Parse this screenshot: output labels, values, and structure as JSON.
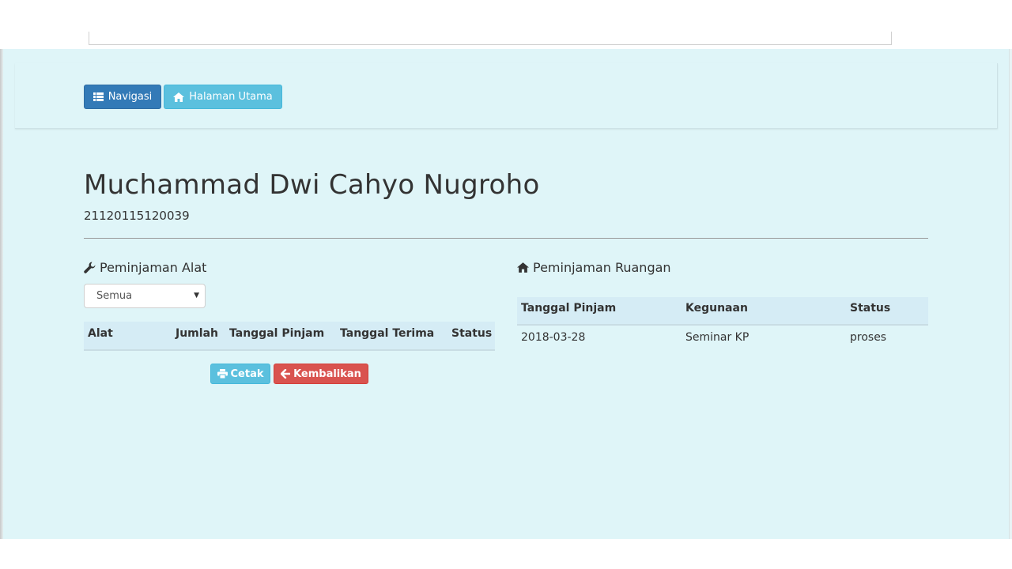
{
  "navbar": {
    "nav_label": "Navigasi",
    "home_label": "Halaman Utama"
  },
  "profile": {
    "name": "Muchammad Dwi Cahyo Nugroho",
    "nim": "21120115120039"
  },
  "alat": {
    "title": "Peminjaman Alat",
    "filter_value": "Semua",
    "columns": [
      "Alat",
      "Jumlah",
      "Tanggal Pinjam",
      "Tanggal Terima",
      "Status"
    ],
    "rows": [],
    "print_label": "Cetak",
    "return_label": "Kembalikan"
  },
  "ruangan": {
    "title": "Peminjaman Ruangan",
    "columns": [
      "Tanggal Pinjam",
      "Kegunaan",
      "Status"
    ],
    "rows": [
      [
        "2018-03-28",
        "Seminar KP",
        "proses"
      ]
    ]
  },
  "colors": {
    "page_bg": "#dff5f8",
    "primary": "#337ab7",
    "info": "#5bc0de",
    "danger": "#d9534f",
    "table_header": "#d5ecf5"
  },
  "icons": {
    "nav": "list-icon",
    "home": "home-icon",
    "wrench": "wrench-icon",
    "room": "home-icon",
    "print": "print-icon",
    "back": "arrow-left-icon"
  }
}
